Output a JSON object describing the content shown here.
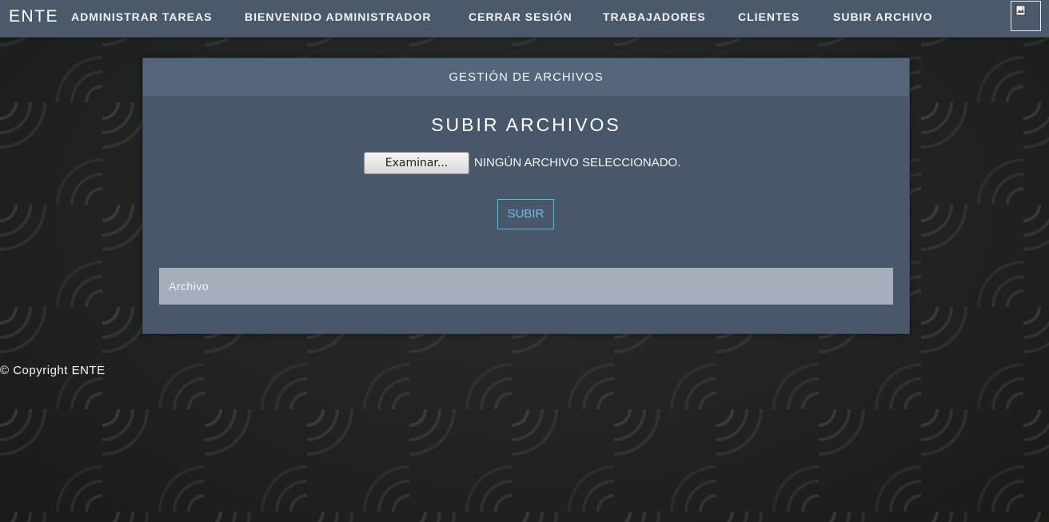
{
  "navbar": {
    "brand": "ENTE",
    "items": [
      {
        "label": "ADMINISTRAR TAREAS"
      },
      {
        "label": "BIENVENIDO ADMINISTRADOR"
      },
      {
        "label": "CERRAR SESIÓN"
      },
      {
        "label": "TRABAJADORES"
      },
      {
        "label": "CLIENTES"
      },
      {
        "label": "SUBIR ARCHIVO"
      }
    ],
    "image_icon": "broken-image-icon"
  },
  "panel": {
    "heading": "GESTIÓN DE ARCHIVOS",
    "title": "SUBIR ARCHIVOS",
    "browse_label": "Examinar...",
    "file_status": "NINGÚN ARCHIVO SELECCIONADO.",
    "submit_label": "SUBIR",
    "table": {
      "columns": [
        "Archivo"
      ]
    }
  },
  "footer": {
    "copyright": "© Copyright ENTE"
  },
  "colors": {
    "navbar_bg": "#4a5a6b",
    "panel_bg": "#48586a",
    "panel_heading_bg": "#56667a",
    "table_header_bg": "#a6aebb",
    "submit_accent": "#5fb5dc"
  }
}
